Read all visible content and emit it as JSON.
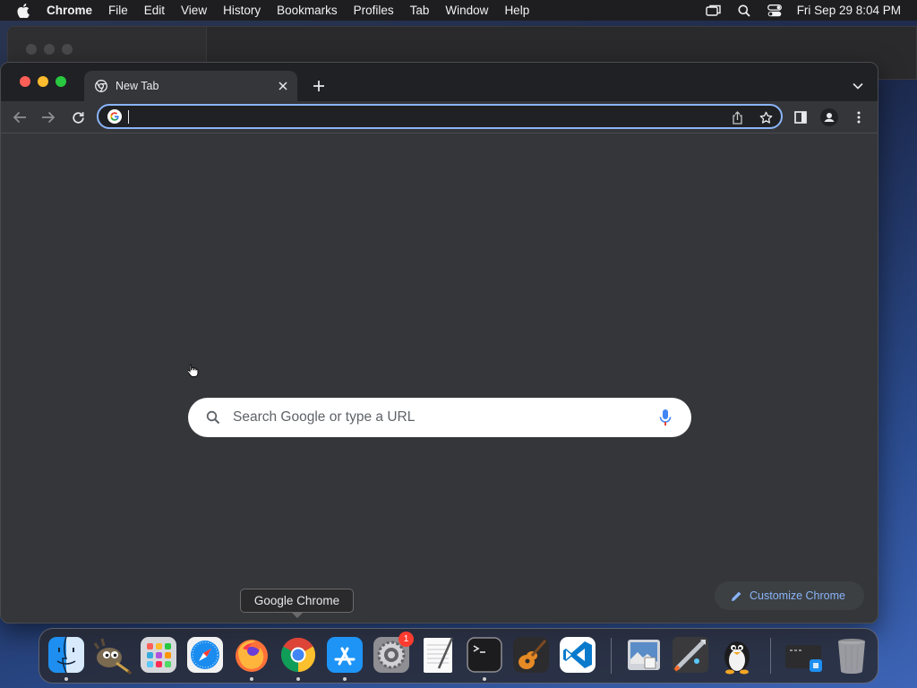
{
  "menubar": {
    "app_name": "Chrome",
    "items": [
      "File",
      "Edit",
      "View",
      "History",
      "Bookmarks",
      "Profiles",
      "Tab",
      "Window",
      "Help"
    ],
    "clock": "Fri Sep 29  8:04 PM",
    "status_icons": [
      "screen-mirroring-icon",
      "spotlight-search-icon",
      "control-center-icon"
    ]
  },
  "browser": {
    "tab": {
      "title": "New Tab",
      "favicon": "chrome-icon"
    },
    "omnibox": {
      "value": "",
      "icon": "google-g-icon"
    },
    "toolbar_icons": [
      "back-icon",
      "forward-icon",
      "reload-icon",
      "share-icon",
      "bookmark-star-icon",
      "side-panel-icon",
      "profile-icon",
      "menu-kebab-icon"
    ],
    "accent_color": "#8ab4f8"
  },
  "ntp": {
    "search_placeholder": "Search Google or type a URL",
    "customize_label": "Customize Chrome"
  },
  "tooltip": "Google Chrome",
  "dock": {
    "apps": [
      {
        "name": "Finder",
        "running": true
      },
      {
        "name": "GIMP",
        "running": false
      },
      {
        "name": "Launchpad",
        "running": false
      },
      {
        "name": "Safari",
        "running": false
      },
      {
        "name": "Firefox",
        "running": true
      },
      {
        "name": "Google Chrome",
        "running": true
      },
      {
        "name": "App Store",
        "running": true
      },
      {
        "name": "System Settings",
        "running": false,
        "badge": "1"
      },
      {
        "name": "TextEdit",
        "running": false
      },
      {
        "name": "Terminal",
        "running": true
      },
      {
        "name": "GarageBand",
        "running": false
      },
      {
        "name": "Visual Studio Code",
        "running": false
      },
      {
        "name": "Preview",
        "running": false
      },
      {
        "name": "Rocket Typist",
        "running": false
      },
      {
        "name": "Tux",
        "running": false
      },
      {
        "name": "Downloads",
        "running": false
      },
      {
        "name": "Trash",
        "running": false
      }
    ]
  }
}
